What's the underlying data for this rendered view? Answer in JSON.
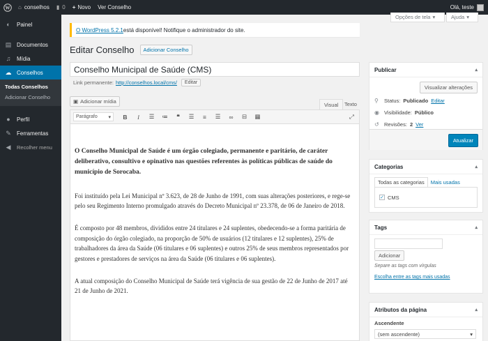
{
  "adminbar": {
    "site_name": "conselhos",
    "comments_count": "0",
    "new_label": "Novo",
    "view_label": "Ver Conselho",
    "greeting": "Olá, teste"
  },
  "sidebar": {
    "items": [
      {
        "label": "Painel",
        "icon": "dashboard-icon"
      },
      {
        "label": "Documentos",
        "icon": "documents-icon"
      },
      {
        "label": "Mídia",
        "icon": "media-icon"
      },
      {
        "label": "Conselhos",
        "icon": "conselhos-icon"
      },
      {
        "label": "Perfil",
        "icon": "profile-icon"
      },
      {
        "label": "Ferramentas",
        "icon": "tools-icon"
      },
      {
        "label": "Recolher menu",
        "icon": "collapse-icon"
      }
    ],
    "submenu": [
      "Todas Conselhos",
      "Adicionar Conselho"
    ]
  },
  "screen_meta": {
    "options": "Opções de tela",
    "help": "Ajuda"
  },
  "notice": {
    "link_text": "O WordPress 5.2.1",
    "text": " está disponível! Notifique o administrador do site."
  },
  "page": {
    "title": "Editar Conselho",
    "add_new": "Adicionar Conselho"
  },
  "post": {
    "title": "Conselho Municipal de Saúde (CMS)",
    "permalink_label": "Link permanente:",
    "permalink_url": "http://conselhos.local/cms/",
    "edit_label": "Editar"
  },
  "editor": {
    "add_media": "Adicionar mídia",
    "tab_visual": "Visual",
    "tab_text": "Texto",
    "format": "Parágrafo",
    "paragraphs": [
      "O Conselho Municipal de Saúde é um órgão colegiado, permanente e paritário, de caráter deliberativo, consultivo e opinativo nas questões referentes às políticas públicas de saúde do município de Sorocaba.",
      "Foi instituído pela Lei Municipal nº 3.623, de 28 de Junho de 1991, com suas alterações posteriores, e rege-se pelo seu Regimento Interno promulgado através do Decreto Municipal nº 23.378, de 06 de Janeiro de 2018.",
      "É composto por 48 membros, divididos entre 24 titulares e 24 suplentes, obedecendo-se a forma paritária de composição do órgão colegiado, na proporção de 50% de usuários (12 titulares e 12 suplentes), 25% de trabalhadores da área da Saúde (06 titulares e 06 suplentes) e outros 25% de seus membros representados por gestores e prestadores de serviços na área da Saúde (06 titulares e 06 suplentes).",
      "A atual composição do Conselho Municipal de Saúde terá vigência de sua gestão de 22 de Junho de 2017 até 21 de Junho de 2021."
    ]
  },
  "publish": {
    "title": "Publicar",
    "preview": "Visualizar alterações",
    "status_label": "Status: ",
    "status_value": "Publicado",
    "status_edit": "Editar",
    "visibility_label": "Visibilidade: ",
    "visibility_value": "Público",
    "revisions_label": "Revisões: ",
    "revisions_value": "2",
    "revisions_link": "Ver",
    "update": "Atualizar"
  },
  "categories": {
    "title": "Categorias",
    "tab_all": "Todas as categorias",
    "tab_popular": "Mais usadas",
    "items": [
      "CMS"
    ]
  },
  "tags": {
    "title": "Tags",
    "add": "Adicionar",
    "hint": "Separe as tags com vírgulas",
    "choose": "Escolha entre as tags mais usadas"
  },
  "attributes": {
    "title": "Atributos da página",
    "parent_label": "Ascendente",
    "parent_value": "(sem ascendente)"
  },
  "colors": {
    "accent": "#0073aa",
    "sidebar": "#23282d",
    "primary": "#0085ba",
    "notice": "#ffb900"
  }
}
